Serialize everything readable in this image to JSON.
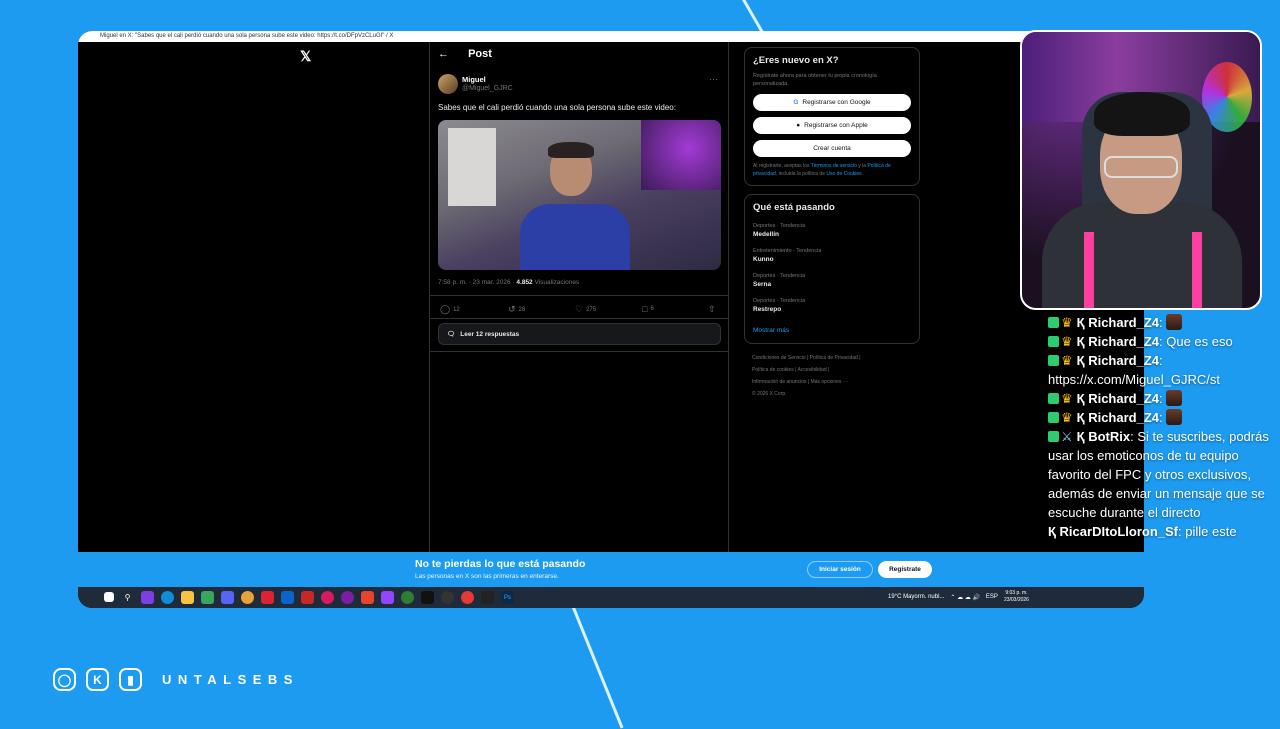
{
  "window_title": "Miguel en X: \"Sabes que el cali perdió cuando una sola persona sube este video: https://t.co/DFpVzCLuGI\" / X",
  "x_page": {
    "logo": "𝕏",
    "post_header": {
      "back": "←",
      "title": "Post"
    },
    "author": {
      "name": "Miguel",
      "handle": "@Miguel_GJRC"
    },
    "tweet_text": "Sabes que el cali perdió cuando una sola persona sube este video:",
    "meta": {
      "time": "7:58 p. m. · 23 mar. 2026 · ",
      "views_count": "4.852",
      "views_label": " Visualizaciones"
    },
    "actions": {
      "replies": "12",
      "reposts": "28",
      "likes": "275",
      "bookmarks": "6"
    },
    "read_replies": "Leer 12 respuestas",
    "signup_card": {
      "title": "¿Eres nuevo en X?",
      "subtitle": "Regístrate ahora para obtener tu propia cronología personalizada.",
      "google": "Registrarse con Google",
      "apple": "Registrarse con Apple",
      "create": "Crear cuenta",
      "legal_prefix": "Al registrarte, aceptas los ",
      "terms": "Términos de servicio",
      "legal_mid": " y la ",
      "privacy": "Política de privacidad",
      "legal_mid2": ", incluida la política de ",
      "cookies": "Uso de Cookies",
      "legal_end": "."
    },
    "trends_card": {
      "title": "Qué está pasando",
      "items": [
        {
          "category": "Deportes · Tendencia",
          "name": "Medellín"
        },
        {
          "category": "Entretenimiento · Tendencia",
          "name": "Kunno"
        },
        {
          "category": "Deportes · Tendencia",
          "name": "Serna"
        },
        {
          "category": "Deportes · Tendencia",
          "name": "Restrepo"
        }
      ],
      "show_more": "Mostrar más"
    },
    "footer": {
      "line1": "Condiciones de Servicio  |  Política de Privacidad  |",
      "line2": "Política de cookies  |  Accesibilidad  |",
      "line3": "Información de anuncios  |  Más opciones ···",
      "line4": "© 2026 X Corp."
    },
    "banner": {
      "title": "No te pierdas lo que está pasando",
      "subtitle": "Las personas en X son las primeras en enterarse.",
      "login": "Iniciar sesión",
      "signup": "Regístrate"
    }
  },
  "taskbar": {
    "weather": "19°C  Mayorm. nubl...",
    "lang": "ESP",
    "time": "9:03 p. m.",
    "date": "23/03/2026"
  },
  "chat": [
    {
      "user": "Richard_Z4",
      "text": ""
    },
    {
      "user": "Richard_Z4",
      "text": "Que es eso"
    },
    {
      "user": "Richard_Z4",
      "text": "https://x.com/Miguel_GJRC/st"
    },
    {
      "user": "Richard_Z4",
      "text": ""
    },
    {
      "user": "Richard_Z4",
      "text": ""
    },
    {
      "user": "BotRix",
      "text": "Si te suscribes, podrás usar los emoticonos de tu equipo favorito del FPC y otros exclusivos, además de enviar un mensaje que se escuche durante el directo"
    },
    {
      "user": "RicarDItoLloron_Sf",
      "text": "pille este"
    }
  ],
  "branding": {
    "handle": "UNTALSEBS"
  },
  "colors": {
    "x_blue": "#1d9bf0",
    "stream_bg": "#1d9bf0",
    "accent_pink": "#ff3f9f"
  }
}
